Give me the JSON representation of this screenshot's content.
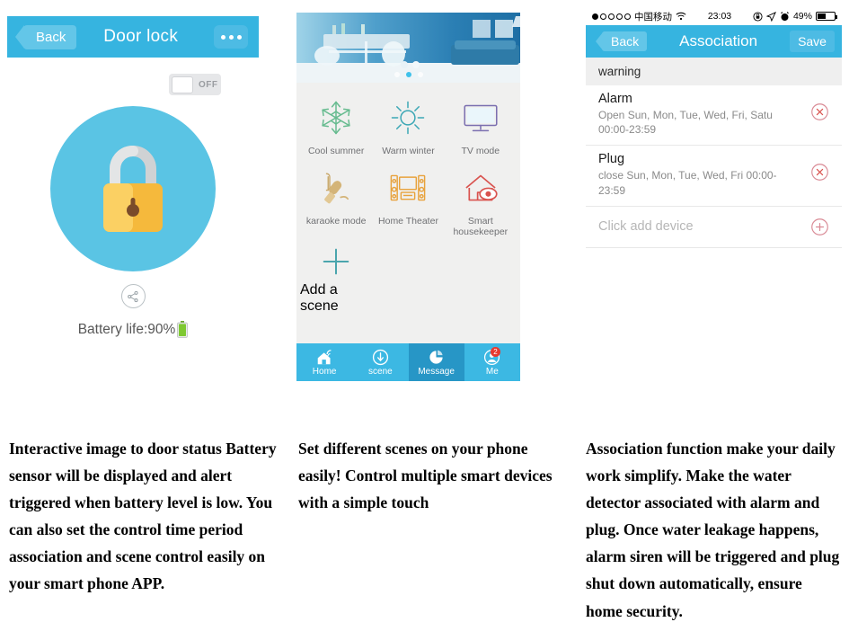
{
  "phone1": {
    "header": {
      "back_label": "Back",
      "title": "Door lock",
      "more_icon": "ellipsis-icon"
    },
    "toggle": {
      "state_label": "OFF",
      "is_on": false
    },
    "lock": {
      "icon": "padlock-closed-icon",
      "circle_color": "#5ac4e4",
      "body_color": "#f7c64b",
      "shackle_color": "#cfd2d4"
    },
    "share_icon": "share-icon",
    "battery": {
      "label": "Battery life:90%",
      "percent": 90,
      "icon": "battery-green-icon",
      "color": "#7ec832"
    }
  },
  "phone2": {
    "banner": {
      "image_alt": "living-room-banner",
      "carousel_dots": 3,
      "active_dot": 1
    },
    "scenes": [
      {
        "label": "Cool summer",
        "icon": "snowflake-icon",
        "color": "#66bb8f"
      },
      {
        "label": "Warm winter",
        "icon": "sun-icon",
        "color": "#3ba7b5"
      },
      {
        "label": "TV mode",
        "icon": "tv-icon",
        "color": "#7b6fb0"
      },
      {
        "label": "karaoke mode",
        "icon": "microphone-icon",
        "color": "#c9a86a"
      },
      {
        "label": "Home Theater",
        "icon": "home-theater-icon",
        "color": "#e8a23c"
      },
      {
        "label": "Smart housekeeper",
        "icon": "house-eye-icon",
        "color": "#d9534f"
      }
    ],
    "add_scene": {
      "label": "Add a scene",
      "icon": "plus-icon",
      "color": "#4aa5ad"
    },
    "tabs": [
      {
        "label": "Home",
        "icon": "home-wifi-icon",
        "active": false,
        "badge": ""
      },
      {
        "label": "scene",
        "icon": "scene-icon",
        "active": false,
        "badge": ""
      },
      {
        "label": "Message",
        "icon": "message-pie-icon",
        "active": true,
        "badge": ""
      },
      {
        "label": "Me",
        "icon": "person-icon",
        "active": false,
        "badge": "2"
      }
    ],
    "colors": {
      "tab_bg": "#3cb8e3",
      "tab_active_bg": "#2796c6",
      "badge": "#e8392f"
    }
  },
  "phone3": {
    "statusbar": {
      "carrier": "中国移动",
      "wifi_icon": "wifi-icon",
      "time": "23:03",
      "lock_rotation_icon": "rotation-lock-icon",
      "location_icon": "location-arrow-icon",
      "alarm_icon": "alarm-clock-icon",
      "battery_label": "49%",
      "battery_percent": 49
    },
    "header": {
      "back_label": "Back",
      "title": "Association",
      "save_label": "Save"
    },
    "section_label": "warning",
    "rows": [
      {
        "name": "Alarm",
        "detail": " Open  Sun, Mon, Tue, Wed, Fri, Satu 00:00-23:59",
        "action_icon": "remove-circle-icon"
      },
      {
        "name": "Plug",
        "detail": "close Sun, Mon, Tue, Wed, Fri 00:00-23:59",
        "action_icon": "remove-circle-icon"
      }
    ],
    "add_row": {
      "label": "Click add device",
      "action_icon": "add-circle-icon"
    },
    "colors": {
      "header": "#36b4e0",
      "accent_light": "#63c6e8",
      "action": "#d98a95"
    }
  },
  "captions": {
    "one": "Interactive image to door status Battery sensor will be displayed and alert triggered when battery level is low.\nYou can also set the control time period association and scene control easily on your smart phone APP.",
    "two": "Set different scenes on your phone easily!\nControl multiple smart devices with a simple touch",
    "three": "Association function make your daily work simplify. Make the water detector associated with alarm and plug. Once water leakage happens, alarm siren will be triggered and plug shut down automatically, ensure home security."
  }
}
